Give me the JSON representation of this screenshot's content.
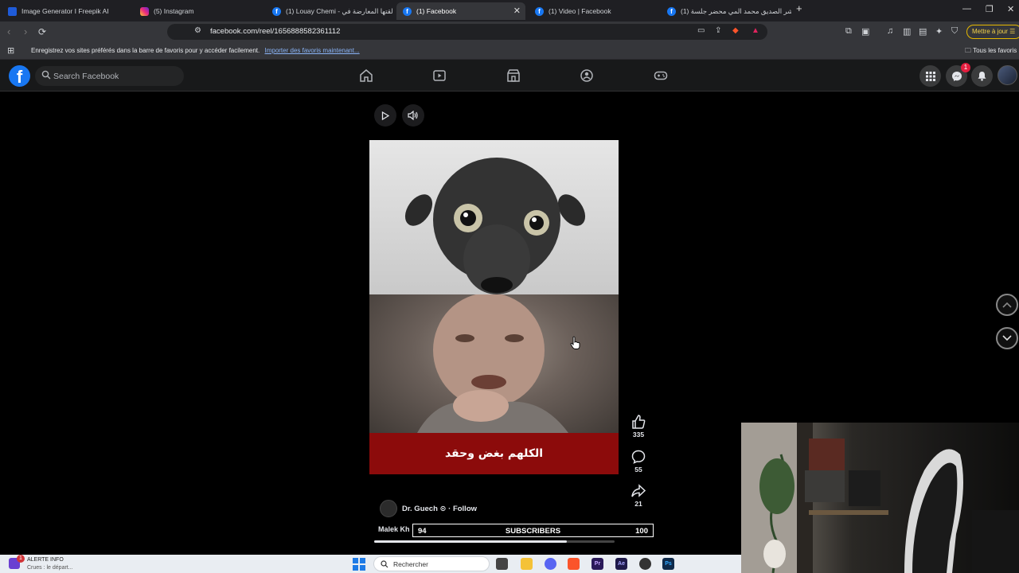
{
  "browser": {
    "tabs": [
      {
        "title": "Image Generator I Freepik AI",
        "favicon": "freepik-icon"
      },
      {
        "title": "(5) Instagram",
        "favicon": "instagram-icon"
      },
      {
        "title": "(1) Louay Chemi - القتها المعارضة في",
        "favicon": "facebook-icon"
      },
      {
        "title": "(1) Facebook",
        "favicon": "facebook-icon",
        "active": true
      },
      {
        "title": "(1) Video | Facebook",
        "favicon": "facebook-icon"
      },
      {
        "title": "(1) نشر الصديق محمد المي محضر جلسة",
        "favicon": "facebook-icon"
      }
    ],
    "url": "facebook.com/reel/1656888582361112",
    "update_button": "Mettre à jour",
    "bookmarks_prompt": "Enregistrez vos sites préférés dans la barre de favoris pour y accéder facilement.",
    "bookmarks_link": "Importer des favoris maintenant...",
    "all_bookmarks": "Tous les favoris"
  },
  "facebook": {
    "logo": "f",
    "search_placeholder": "Search Facebook",
    "nav": [
      "home-icon",
      "video-icon",
      "marketplace-icon",
      "groups-icon",
      "gaming-icon"
    ],
    "messenger_badge": "1"
  },
  "reel": {
    "caption": "الكلهم بغض وحقد",
    "likes": "335",
    "comments": "55",
    "shares": "21",
    "author": "Dr. Guech",
    "follow": "Follow",
    "description": "Malek Kh",
    "progress": 0.8
  },
  "subscribers_overlay": {
    "current": "94",
    "label": "SUBSCRIBERS",
    "goal": "100"
  },
  "taskbar": {
    "alert_title": "ALERTE INFO",
    "alert_subtitle": "Crues : le départ...",
    "alert_badge": "1",
    "search_placeholder": "Rechercher",
    "apps": [
      {
        "name": "file-explorer-icon",
        "label": ""
      },
      {
        "name": "folder-icon",
        "label": ""
      },
      {
        "name": "discord-icon",
        "label": ""
      },
      {
        "name": "brave-icon",
        "label": ""
      },
      {
        "name": "premiere-icon",
        "label": "Pr"
      },
      {
        "name": "after-effects-icon",
        "label": "Ae"
      },
      {
        "name": "davinci-icon",
        "label": ""
      },
      {
        "name": "photoshop-icon",
        "label": "Ps"
      }
    ]
  }
}
